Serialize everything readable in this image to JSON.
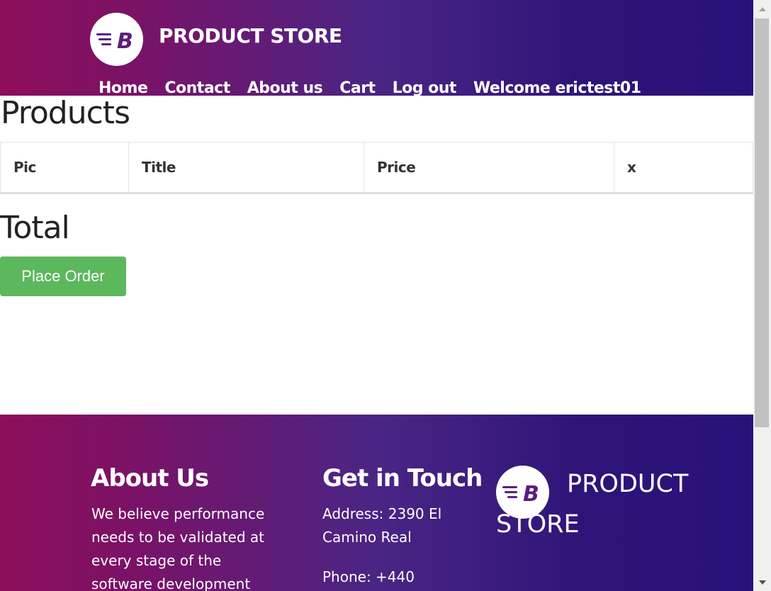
{
  "header": {
    "brand_name": "PRODUCT STORE",
    "logo_icon": "blazemeter-logo-icon",
    "nav": [
      {
        "label": "Home"
      },
      {
        "label": "Contact"
      },
      {
        "label": "About us"
      },
      {
        "label": "Cart"
      },
      {
        "label": "Log out"
      },
      {
        "label": "Welcome erictest01"
      }
    ]
  },
  "main": {
    "title": "Products",
    "table": {
      "columns": [
        "Pic",
        "Title",
        "Price",
        "x"
      ],
      "rows": []
    },
    "total_label": "Total",
    "place_order_label": "Place Order"
  },
  "footer": {
    "about_title": "About Us",
    "about_text": "We believe performance needs to be validated at every stage of the software development cycle and our",
    "contact_title": "Get in Touch",
    "address": "Address: 2390 El Camino Real",
    "phone": "Phone: +440",
    "brand_name": "PRODUCT STORE"
  },
  "colors": {
    "gradient_start": "#8e0e5a",
    "gradient_end": "#2a117a",
    "place_order_button": "#5cb85c"
  }
}
